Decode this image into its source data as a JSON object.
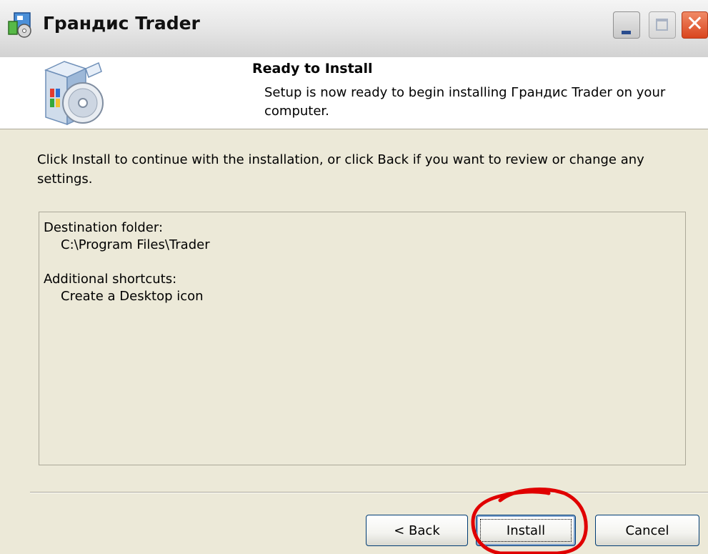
{
  "window": {
    "title": "Грандис Trader",
    "controls": {
      "minimize": "minimize-icon",
      "maximize": "maximize-icon",
      "close": "close-icon"
    }
  },
  "header": {
    "title": "Ready to Install",
    "subtitle": "Setup is now ready to begin installing Грандис Trader on your computer."
  },
  "body": {
    "intro": "Click Install to continue with the installation, or click Back if you want to review or change any settings.",
    "memo": [
      {
        "label": "Destination folder:",
        "value": "C:\\Program Files\\Trader"
      },
      {
        "label": "Additional shortcuts:",
        "value": "Create a Desktop icon"
      }
    ]
  },
  "buttons": {
    "back": "< Back",
    "install": "Install",
    "cancel": "Cancel"
  },
  "colors": {
    "dialog_bg": "#ece9d8",
    "header_bg": "#ffffff",
    "annotation": "#e00000",
    "close_button": "#d9451e"
  }
}
